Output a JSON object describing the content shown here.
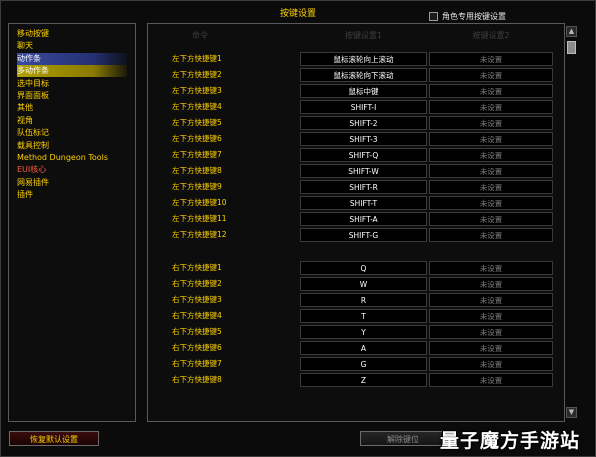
{
  "window": {
    "title": "按键设置",
    "character_specific_label": "角色专用按键设置",
    "character_specific_checked": false
  },
  "columns": {
    "command": "命令",
    "key1": "按键设置1",
    "key2": "按键设置2"
  },
  "categories": [
    {
      "label": "移动按键",
      "state": "normal"
    },
    {
      "label": "聊天",
      "state": "normal"
    },
    {
      "label": "动作条",
      "state": "selected-blue"
    },
    {
      "label": "多动作条",
      "state": "selected-yellow"
    },
    {
      "label": "选中目标",
      "state": "normal"
    },
    {
      "label": "界面面板",
      "state": "normal"
    },
    {
      "label": "其他",
      "state": "normal"
    },
    {
      "label": "视角",
      "state": "normal"
    },
    {
      "label": "队伍标记",
      "state": "normal"
    },
    {
      "label": "载具控制",
      "state": "normal"
    },
    {
      "label": "Method Dungeon Tools",
      "state": "normal"
    },
    {
      "label": "EUI核心",
      "state": "addon-red"
    },
    {
      "label": "网易插件",
      "state": "normal"
    },
    {
      "label": "插件",
      "state": "normal"
    }
  ],
  "bindings_group_1": [
    {
      "command": "左下方快捷键1",
      "key1": "鼠标滚轮向上滚动",
      "key2": "未设置"
    },
    {
      "command": "左下方快捷键2",
      "key1": "鼠标滚轮向下滚动",
      "key2": "未设置"
    },
    {
      "command": "左下方快捷键3",
      "key1": "鼠标中键",
      "key2": "未设置"
    },
    {
      "command": "左下方快捷键4",
      "key1": "SHIFT-I",
      "key2": "未设置"
    },
    {
      "command": "左下方快捷键5",
      "key1": "SHIFT-2",
      "key2": "未设置"
    },
    {
      "command": "左下方快捷键6",
      "key1": "SHIFT-3",
      "key2": "未设置"
    },
    {
      "command": "左下方快捷键7",
      "key1": "SHIFT-Q",
      "key2": "未设置"
    },
    {
      "command": "左下方快捷键8",
      "key1": "SHIFT-W",
      "key2": "未设置"
    },
    {
      "command": "左下方快捷键9",
      "key1": "SHIFT-R",
      "key2": "未设置"
    },
    {
      "command": "左下方快捷键10",
      "key1": "SHIFT-T",
      "key2": "未设置"
    },
    {
      "command": "左下方快捷键11",
      "key1": "SHIFT-A",
      "key2": "未设置"
    },
    {
      "command": "左下方快捷键12",
      "key1": "SHIFT-G",
      "key2": "未设置"
    }
  ],
  "bindings_group_2": [
    {
      "command": "右下方快捷键1",
      "key1": "Q",
      "key2": "未设置"
    },
    {
      "command": "右下方快捷键2",
      "key1": "W",
      "key2": "未设置"
    },
    {
      "command": "右下方快捷键3",
      "key1": "R",
      "key2": "未设置"
    },
    {
      "command": "右下方快捷键4",
      "key1": "T",
      "key2": "未设置"
    },
    {
      "command": "右下方快捷键5",
      "key1": "Y",
      "key2": "未设置"
    },
    {
      "command": "右下方快捷键6",
      "key1": "A",
      "key2": "未设置"
    },
    {
      "command": "右下方快捷键7",
      "key1": "G",
      "key2": "未设置"
    },
    {
      "command": "右下方快捷键8",
      "key1": "Z",
      "key2": "未设置"
    }
  ],
  "scrollbar": {
    "up_icon": "chevron-up-icon",
    "down_icon": "chevron-down-icon"
  },
  "buttons": {
    "reset_defaults": "恢复默认设置",
    "unbind": "解除键位"
  },
  "watermark": "量子魔方手游站",
  "colors": {
    "label_gold": "#ffd100",
    "key_white": "#ffffff",
    "unset_gray": "#7a7a7a",
    "selected_blue": "#3a4aa0",
    "selected_yellow": "#b0a000",
    "addon_red": "#ff5a3c"
  }
}
